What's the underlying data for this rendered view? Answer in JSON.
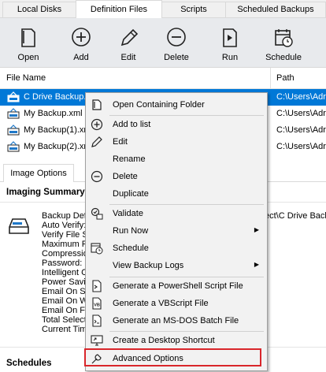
{
  "tabs": [
    "Local Disks",
    "Definition Files",
    "Scripts",
    "Scheduled Backups"
  ],
  "active_tab": "Definition Files",
  "toolbar": {
    "open": "Open",
    "add": "Add",
    "edit": "Edit",
    "delete": "Delete",
    "run": "Run",
    "schedule": "Schedule"
  },
  "list": {
    "col_name": "File Name",
    "col_path": "Path",
    "rows": [
      {
        "name": "C Drive Backup.xml",
        "path": "C:\\Users\\Adr",
        "selected": true
      },
      {
        "name": "My Backup.xml",
        "path": "C:\\Users\\Adr",
        "selected": false
      },
      {
        "name": "My Backup(1).xml",
        "path": "C:\\Users\\Adr",
        "selected": false
      },
      {
        "name": "My Backup(2).xml",
        "path": "C:\\Users\\Adr",
        "selected": false
      }
    ]
  },
  "lower_tab": "Image Options",
  "imaging_summary": {
    "title": "Imaging Summary",
    "lines": [
      "Backup Defi",
      "Auto Verify:",
      "Verify File Sy",
      "Maximum Fil",
      "Compressio",
      "Password:",
      "Intelligent Co",
      "Power Savin",
      "Email On Su",
      "Email On Wa",
      "Email On Fa",
      "Total Select",
      "Current Time"
    ],
    "right_text": "ect\\C Drive Back"
  },
  "schedules_title": "Schedules",
  "context_menu": {
    "items": [
      {
        "label": "Open Containing Folder",
        "icon": "folder-icon",
        "submenu": false
      },
      {
        "label": "Add to list",
        "icon": "plus-circle-icon",
        "submenu": false
      },
      {
        "label": "Edit",
        "icon": "pencil-icon",
        "submenu": false
      },
      {
        "label": "Rename",
        "icon": "",
        "submenu": false
      },
      {
        "label": "Delete",
        "icon": "minus-circle-icon",
        "submenu": false
      },
      {
        "label": "Duplicate",
        "icon": "",
        "submenu": false
      },
      {
        "label": "Validate",
        "icon": "validate-icon",
        "submenu": false
      },
      {
        "label": "Run Now",
        "icon": "",
        "submenu": true
      },
      {
        "label": "Schedule",
        "icon": "calendar-clock-icon",
        "submenu": false
      },
      {
        "label": "View Backup Logs",
        "icon": "",
        "submenu": true
      },
      {
        "label": "Generate a PowerShell Script File",
        "icon": "powershell-file-icon",
        "submenu": false
      },
      {
        "label": "Generate a VBScript File",
        "icon": "vbscript-file-icon",
        "submenu": false
      },
      {
        "label": "Generate an MS-DOS Batch File",
        "icon": "batch-file-icon",
        "submenu": false
      },
      {
        "label": "Create a Desktop Shortcut",
        "icon": "monitor-shortcut-icon",
        "submenu": false
      },
      {
        "label": "Advanced Options",
        "icon": "wrench-icon",
        "submenu": false
      }
    ]
  },
  "colors": {
    "selection": "#0078d7",
    "highlight_border": "#d9262b",
    "toolbar_bg": "#e8eaed"
  }
}
